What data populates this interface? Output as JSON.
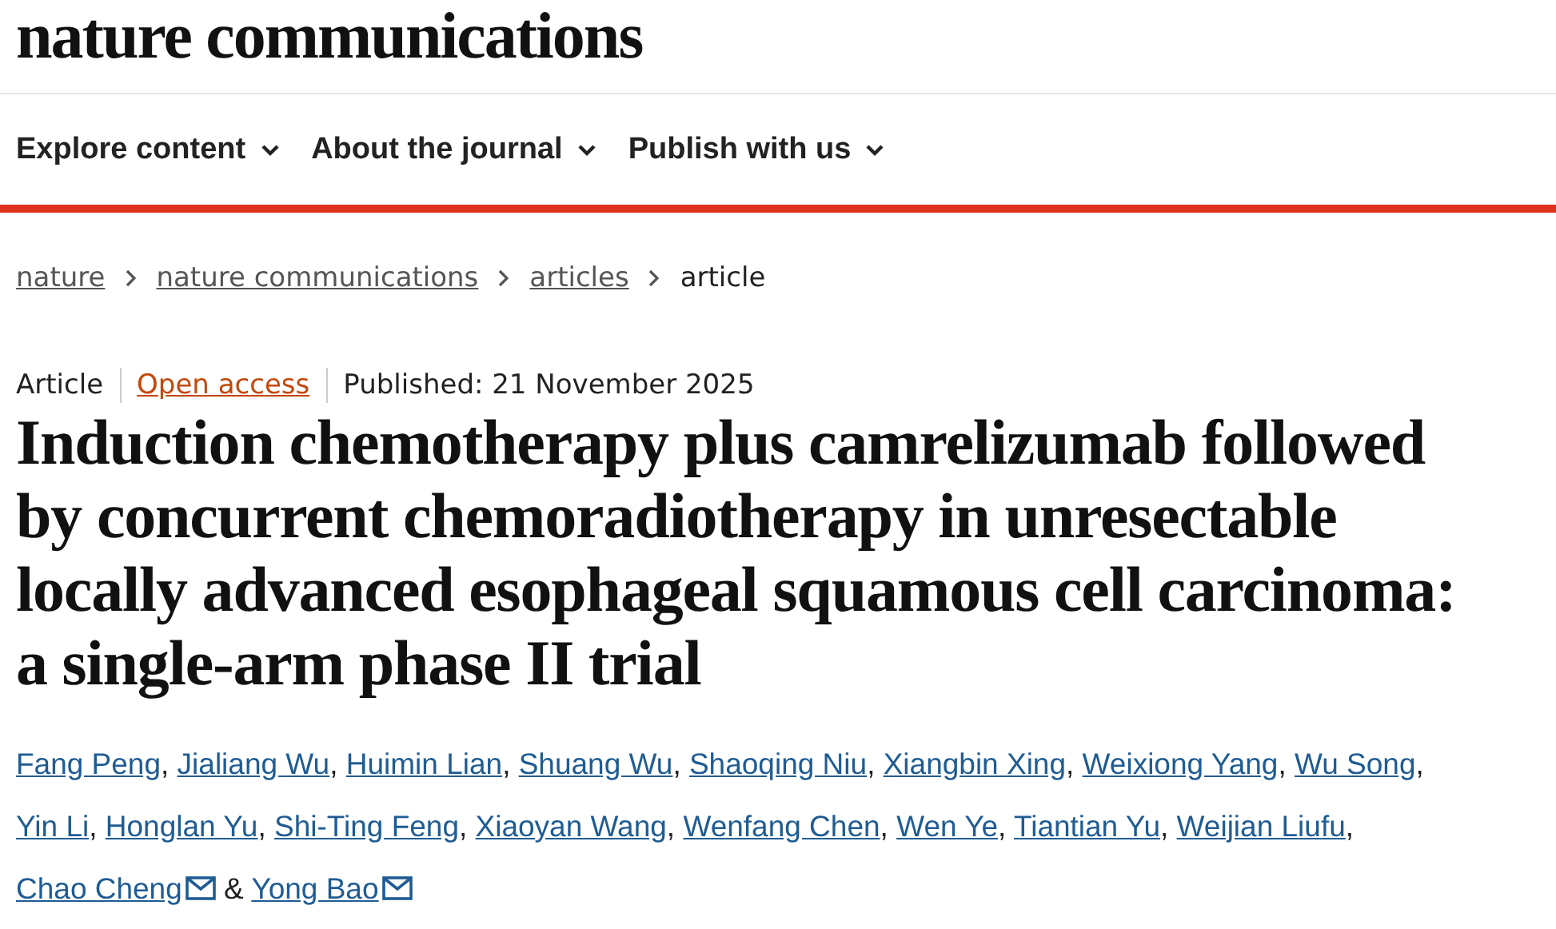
{
  "site": {
    "logo": "nature communications"
  },
  "nav": [
    {
      "label": "Explore content"
    },
    {
      "label": "About the journal"
    },
    {
      "label": "Publish with us"
    }
  ],
  "breadcrumb": [
    {
      "label": "nature",
      "current": false
    },
    {
      "label": "nature communications",
      "current": false
    },
    {
      "label": "articles",
      "current": false
    },
    {
      "label": "article",
      "current": true
    }
  ],
  "article": {
    "type": "Article",
    "access": "Open access",
    "published": "Published: 21 November 2025",
    "title": "Induction chemotherapy plus camrelizumab followed by concurrent chemoradiotherapy in unresectable locally advanced esophageal squamous cell carcinoma: a single-arm phase II trial",
    "authors": [
      {
        "name": "Fang Peng",
        "email": false,
        "separator": ","
      },
      {
        "name": "Jialiang Wu",
        "email": false,
        "separator": ","
      },
      {
        "name": "Huimin Lian",
        "email": false,
        "separator": ","
      },
      {
        "name": "Shuang Wu",
        "email": false,
        "separator": ","
      },
      {
        "name": "Shaoqing Niu",
        "email": false,
        "separator": ","
      },
      {
        "name": "Xiangbin Xing",
        "email": false,
        "separator": ","
      },
      {
        "name": "Weixiong Yang",
        "email": false,
        "separator": ","
      },
      {
        "name": "Wu Song",
        "email": false,
        "separator": ","
      },
      {
        "name": "Yin Li",
        "email": false,
        "separator": ","
      },
      {
        "name": "Honglan Yu",
        "email": false,
        "separator": ","
      },
      {
        "name": "Shi-Ting Feng",
        "email": false,
        "separator": ","
      },
      {
        "name": "Xiaoyan Wang",
        "email": false,
        "separator": ","
      },
      {
        "name": "Wenfang Chen",
        "email": false,
        "separator": ","
      },
      {
        "name": "Wen Ye",
        "email": false,
        "separator": ","
      },
      {
        "name": "Tiantian Yu",
        "email": false,
        "separator": ","
      },
      {
        "name": "Weijian Liufu",
        "email": false,
        "separator": ","
      },
      {
        "name": "Chao Cheng",
        "email": true,
        "separator": "&"
      },
      {
        "name": "Yong Bao",
        "email": true
      }
    ]
  }
}
